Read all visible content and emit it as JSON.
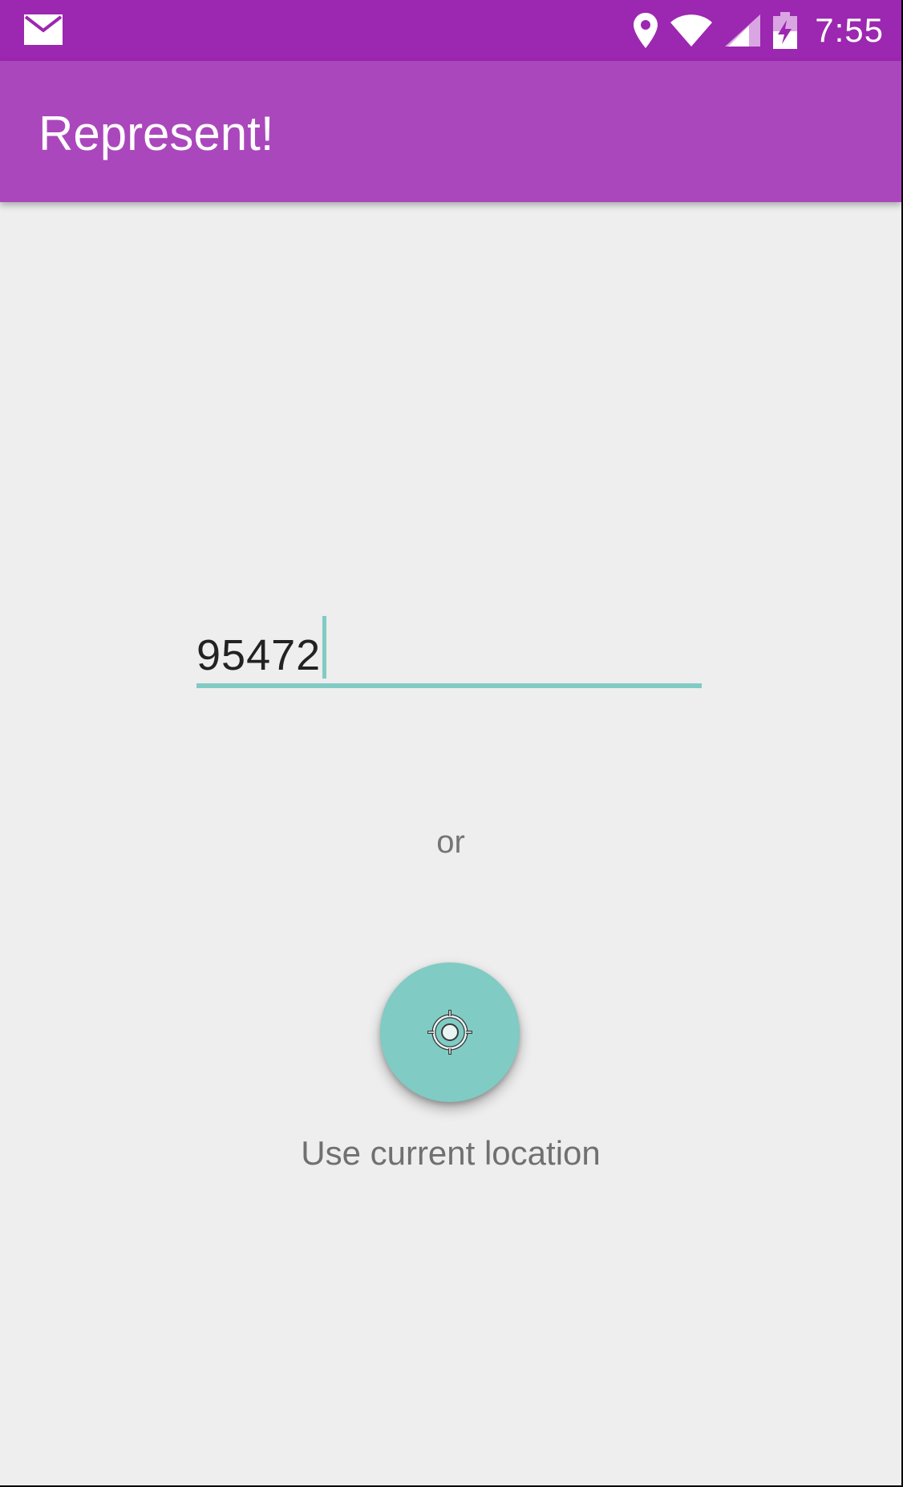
{
  "status_bar": {
    "time": "7:55",
    "icons": [
      "mail-icon",
      "location-pin-icon",
      "wifi-icon",
      "signal-icon",
      "battery-charging-icon"
    ]
  },
  "app_bar": {
    "title": "Represent!"
  },
  "zip_input": {
    "value": "95472"
  },
  "divider_text": "or",
  "location_button": {
    "icon": "crosshair-location-icon",
    "label": "Use current location"
  },
  "colors": {
    "status_bar": "#9c27b0",
    "app_bar": "#ab47bc",
    "accent": "#80cbc4",
    "background": "#eeeeee"
  }
}
